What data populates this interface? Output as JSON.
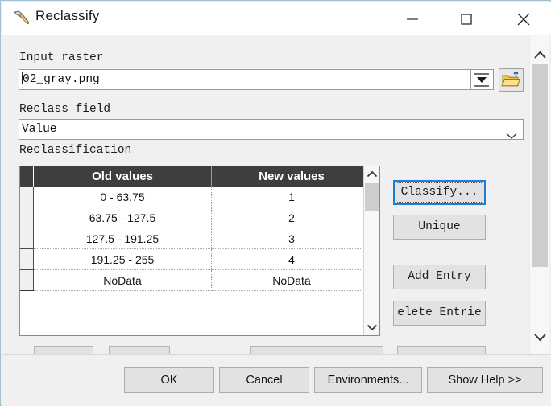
{
  "window": {
    "title": "Reclassify",
    "icon": "hammer-tool-icon",
    "controls": {
      "minimize": "minimize-icon",
      "maximize": "maximize-icon",
      "close": "close-icon"
    }
  },
  "form": {
    "input_raster": {
      "label": "Input raster",
      "value": "02_gray.png",
      "dropdown_icon": "dropdown-arrow-icon",
      "browse_icon": "folder-open-icon"
    },
    "reclass_field": {
      "label": "Reclass field",
      "value": "Value",
      "chevron_icon": "chevron-down-icon"
    },
    "reclassification": {
      "label": "Reclassification"
    }
  },
  "table": {
    "columns": [
      "Old values",
      "New values"
    ],
    "rows": [
      [
        "0 - 63.75",
        "1"
      ],
      [
        "63.75 - 127.5",
        "2"
      ],
      [
        "127.5 - 191.25",
        "3"
      ],
      [
        "191.25 - 255",
        "4"
      ],
      [
        "NoData",
        "NoData"
      ]
    ],
    "scrollbar": {
      "up_icon": "chevron-up-icon",
      "down_icon": "chevron-down-icon"
    }
  },
  "side_buttons": {
    "classify": "Classify...",
    "unique": "Unique",
    "add_entry": "Add Entry",
    "delete_entries": "elete Entrie"
  },
  "main_scrollbar": {
    "up_icon": "chevron-up-icon",
    "down_icon": "chevron-down-icon"
  },
  "footer": {
    "ok": "OK",
    "cancel": "Cancel",
    "environments": "Environments...",
    "show_help": "Show Help >>"
  },
  "colors": {
    "accent_focus": "#1a7fd4",
    "table_header_bg": "#3e3e3e",
    "dialog_bg": "#f0f0f0",
    "window_border": "#9fc0d4"
  }
}
